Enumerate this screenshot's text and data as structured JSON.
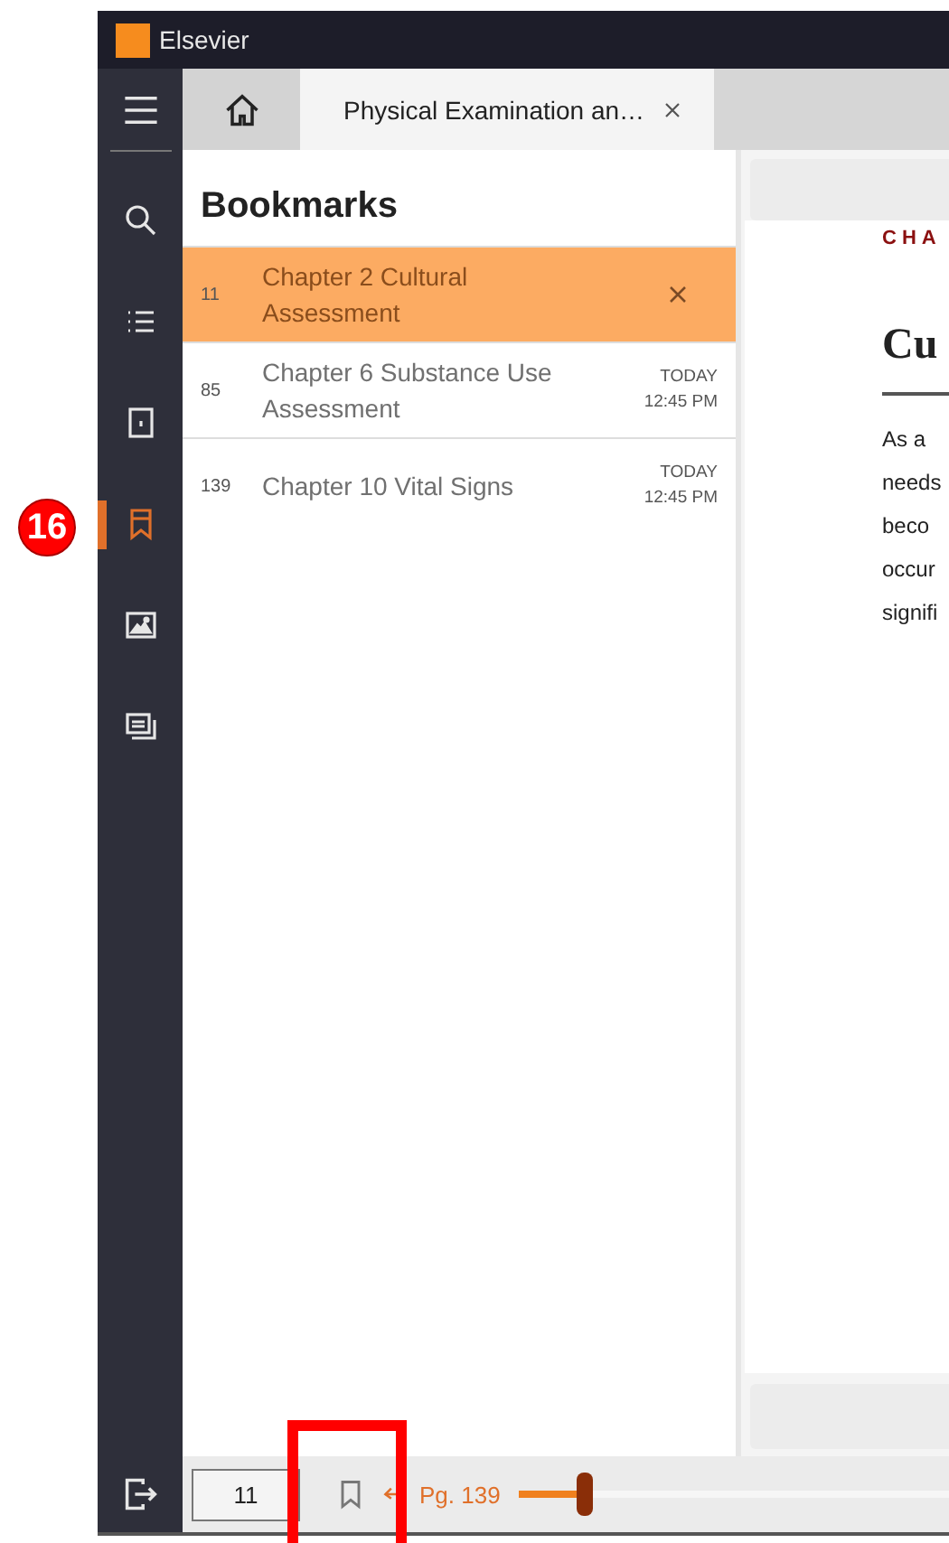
{
  "window": {
    "title": "Elsevier"
  },
  "annotation": {
    "badge": "16"
  },
  "sidebar": {
    "items": [
      {
        "kind": "search",
        "selected": false
      },
      {
        "kind": "contents",
        "selected": false
      },
      {
        "kind": "notes",
        "selected": false
      },
      {
        "kind": "bookmarks",
        "selected": true
      },
      {
        "kind": "images",
        "selected": false
      },
      {
        "kind": "cards",
        "selected": false
      }
    ]
  },
  "tabs": [
    {
      "kind": "home",
      "selected": false
    },
    {
      "kind": "book",
      "label": "Physical Examination an…",
      "selected": true
    }
  ],
  "bookmarks": {
    "title": "Bookmarks",
    "items": [
      {
        "page": "11",
        "title": "Chapter 2 Cultural Assessment",
        "selected": true
      },
      {
        "page": "85",
        "title": "Chapter 6 Substance Use Assessment",
        "day": "TODAY",
        "time": "12:45 PM",
        "selected": false
      },
      {
        "page": "139",
        "title": "Chapter 10 Vital Signs",
        "day": "TODAY",
        "time": "12:45 PM",
        "selected": false
      }
    ]
  },
  "content": {
    "label": "CHA",
    "heading": "Cu",
    "lines": [
      "As a",
      "needs",
      "beco",
      "occur",
      "signifi"
    ]
  },
  "footer": {
    "page_value": "11",
    "page_label": "Pg. 139",
    "slider": {
      "level": 0.15
    }
  }
}
